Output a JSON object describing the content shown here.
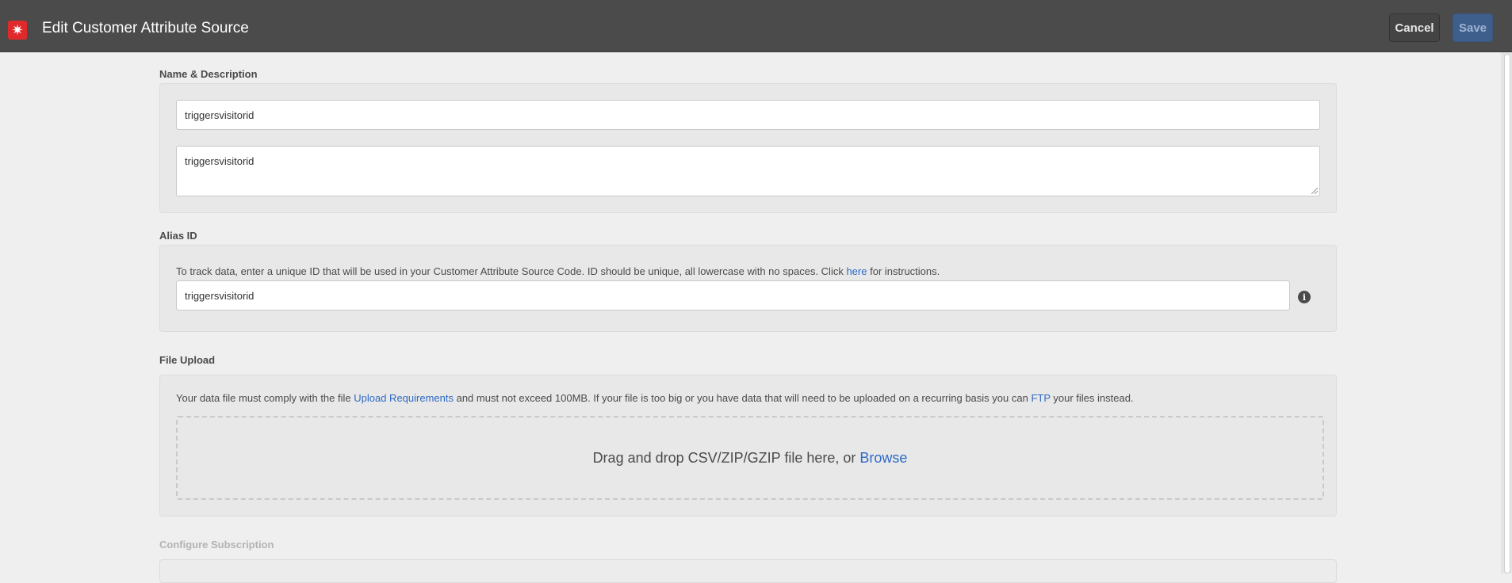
{
  "header": {
    "title": "Edit Customer Attribute Source",
    "logo_icon": "adobe-logo-icon",
    "cancel_label": "Cancel",
    "save_label": "Save",
    "accent_color": "#3e5e8c",
    "logo_color": "#e0292b"
  },
  "name_description": {
    "label": "Name & Description",
    "name_value": "triggersvisitorid",
    "description_value": "triggersvisitorid"
  },
  "alias": {
    "label": "Alias ID",
    "help_before": "To track data, enter a unique ID that will be used in your Customer Attribute Source Code. ID should be unique, all lowercase with no spaces. Click ",
    "help_link": "here",
    "help_after": " for instructions.",
    "value": "triggersvisitorid",
    "info_icon": "info-icon"
  },
  "file_upload": {
    "label": "File Upload",
    "help_before": "Your data file must comply with the file ",
    "help_link1": "Upload Requirements",
    "help_middle": " and must not exceed 100MB. If your file is too big or you have data that will need to be uploaded on a recurring basis you can ",
    "help_link2": "FTP",
    "help_after": " your files instead.",
    "drop_text": "Drag and drop CSV/ZIP/GZIP file here, or ",
    "browse_label": "Browse"
  },
  "subscription": {
    "label": "Configure Subscription"
  }
}
